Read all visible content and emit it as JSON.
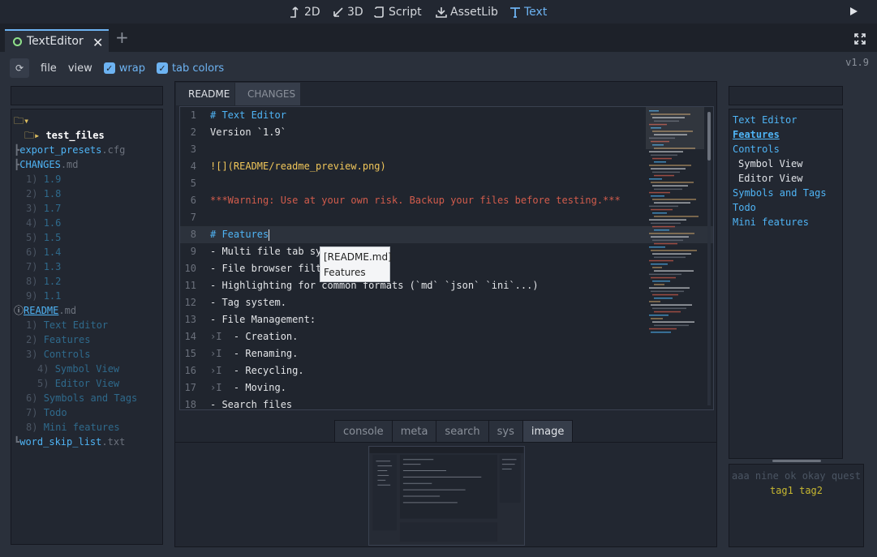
{
  "topbar": {
    "modes": [
      {
        "label": "2D",
        "icon": "2d-move-icon"
      },
      {
        "label": "3D",
        "icon": "3d-rotate-icon"
      },
      {
        "label": "Script",
        "icon": "script-icon"
      },
      {
        "label": "AssetLib",
        "icon": "assetlib-download-icon"
      },
      {
        "label": "Text",
        "icon": "text-icon",
        "active": true
      }
    ],
    "play_icon": "play-icon"
  },
  "tabbar": {
    "editor_tab": "TextEditor",
    "close_glyph": "✕",
    "add_glyph": "+"
  },
  "menubar": {
    "sync_icon": "⟳",
    "file": "file",
    "view": "view",
    "wrap": "wrap",
    "tab_colors": "tab colors",
    "check_glyph": "✓",
    "version": "v1.9"
  },
  "file_tree": {
    "root_icon": "🗀▾",
    "test_files": "test_files",
    "export_presets_name": "export_presets",
    "export_presets_ext": ".cfg",
    "changes_name": "CHANGES",
    "changes_ext": ".md",
    "changes_items": [
      {
        "num": "1)",
        "label": "1.9"
      },
      {
        "num": "2)",
        "label": "1.8"
      },
      {
        "num": "3)",
        "label": "1.7"
      },
      {
        "num": "4)",
        "label": "1.6"
      },
      {
        "num": "5)",
        "label": "1.5"
      },
      {
        "num": "6)",
        "label": "1.4"
      },
      {
        "num": "7)",
        "label": "1.3"
      },
      {
        "num": "8)",
        "label": "1.2"
      },
      {
        "num": "9)",
        "label": "1.1"
      }
    ],
    "readme_name": "README",
    "readme_ext": ".md",
    "readme_items": [
      {
        "num": "1)",
        "label": "Text Editor",
        "level": 1
      },
      {
        "num": "2)",
        "label": "Features",
        "level": 1
      },
      {
        "num": "3)",
        "label": "Controls",
        "level": 1
      },
      {
        "num": "4)",
        "label": "Symbol View",
        "level": 2
      },
      {
        "num": "5)",
        "label": "Editor View",
        "level": 2
      },
      {
        "num": "6)",
        "label": "Symbols and Tags",
        "level": 1
      },
      {
        "num": "7)",
        "label": "Todo",
        "level": 1
      },
      {
        "num": "8)",
        "label": "Mini features",
        "level": 1
      }
    ],
    "word_skip_name": "word_skip_list",
    "word_skip_ext": ".txt"
  },
  "editor": {
    "tabs": [
      "README",
      "CHANGES"
    ],
    "lines": [
      {
        "n": "1",
        "t": "# Text Editor",
        "kind": "h"
      },
      {
        "n": "2",
        "t": "Version `1.9`",
        "kind": "ver"
      },
      {
        "n": "3",
        "t": "",
        "kind": "plain"
      },
      {
        "n": "4",
        "t": "![](README/readme_preview.png)",
        "kind": "img"
      },
      {
        "n": "5",
        "t": "",
        "kind": "plain"
      },
      {
        "n": "6",
        "t": "***Warning: Use at your own risk. Backup your files before testing.***",
        "kind": "warn"
      },
      {
        "n": "7",
        "t": "",
        "kind": "plain"
      },
      {
        "n": "8",
        "t": "# Features",
        "kind": "h",
        "current": true
      },
      {
        "n": "9",
        "t": "- Multi file tab sys",
        "kind": "plain"
      },
      {
        "n": "10",
        "t": "- File browser filte",
        "kind": "plain"
      },
      {
        "n": "11",
        "t": "- Highlighting for common formats (`md` `json` `ini`...)",
        "kind": "plain"
      },
      {
        "n": "12",
        "t": "- Tag system.",
        "kind": "plain"
      },
      {
        "n": "13",
        "t": "- File Management:",
        "kind": "plain"
      },
      {
        "n": "14",
        "t": "  - Creation.",
        "kind": "tab"
      },
      {
        "n": "15",
        "t": "  - Renaming.",
        "kind": "tab"
      },
      {
        "n": "16",
        "t": "  - Recycling.",
        "kind": "tab"
      },
      {
        "n": "17",
        "t": "  - Moving.",
        "kind": "tab"
      },
      {
        "n": "18",
        "t": "- Search files",
        "kind": "plain"
      }
    ],
    "tab_marker": "›I",
    "tooltip": {
      "line1": "[README.md]",
      "line2": "Features"
    }
  },
  "bottom_tabs": [
    "console",
    "meta",
    "search",
    "sys",
    "image"
  ],
  "bottom_active": "image",
  "outline": [
    {
      "label": "Text Editor",
      "level": 1
    },
    {
      "label": "Features",
      "level": 1,
      "active": true
    },
    {
      "label": "Controls",
      "level": 1
    },
    {
      "label": "Symbol View",
      "level": 2
    },
    {
      "label": "Editor View",
      "level": 2
    },
    {
      "label": "Symbols and Tags",
      "level": 1
    },
    {
      "label": "Todo",
      "level": 1
    },
    {
      "label": "Mini features",
      "level": 1
    }
  ],
  "tags": {
    "all": "aaa nine ok okay quest",
    "selected": "tag1 tag2"
  },
  "colors": {
    "accent": "#6db3f2",
    "heading": "#4fb4f5",
    "warning": "#d25c4c",
    "string": "#c8a068",
    "tag_selected": "#c8b830"
  }
}
